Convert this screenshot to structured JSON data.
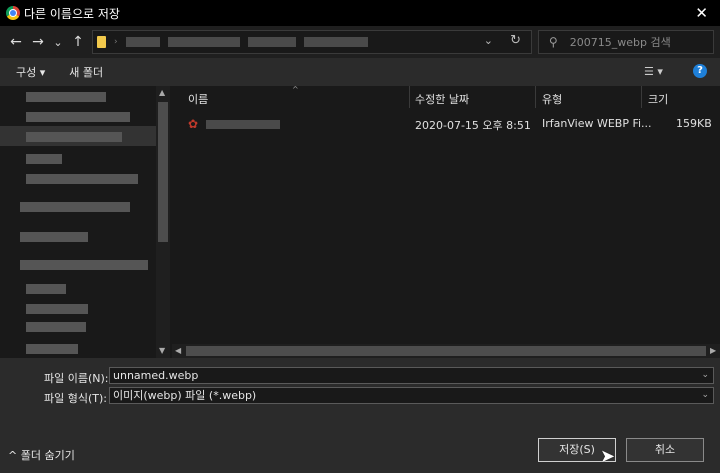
{
  "window": {
    "title": "다른 이름으로 저장",
    "close_label": "✕"
  },
  "nav": {
    "back_icon": "←",
    "forward_icon": "→",
    "recent_icon": "⌄",
    "up_icon": "↑",
    "address_dropdown": "⌄",
    "refresh_icon": "↻",
    "search_placeholder": "200715_webp 검색"
  },
  "toolbar": {
    "organize_label": "구성 ▾",
    "new_folder_label": "새 폴더",
    "view_icon": "☰ ▾",
    "help_label": "?"
  },
  "columns": {
    "name": "이름",
    "modified": "수정한 날짜",
    "type": "유형",
    "size": "크기"
  },
  "files": [
    {
      "modified": "2020-07-15 오후 8:51",
      "type": "IrfanView WEBP Fi...",
      "size": "159KB"
    }
  ],
  "form": {
    "filename_label": "파일 이름(N):",
    "filename_value": "unnamed.webp",
    "filetype_label": "파일 형식(T):",
    "filetype_value": "이미지(webp) 파일 (*.webp)"
  },
  "footer": {
    "hide_folders_label": "^ 폴더 숨기기",
    "save_label": "저장(S)",
    "cancel_label": "취소"
  },
  "colors": {
    "accent": "#1e7fd8",
    "background": "#2b2b2b",
    "pane": "#191919"
  }
}
